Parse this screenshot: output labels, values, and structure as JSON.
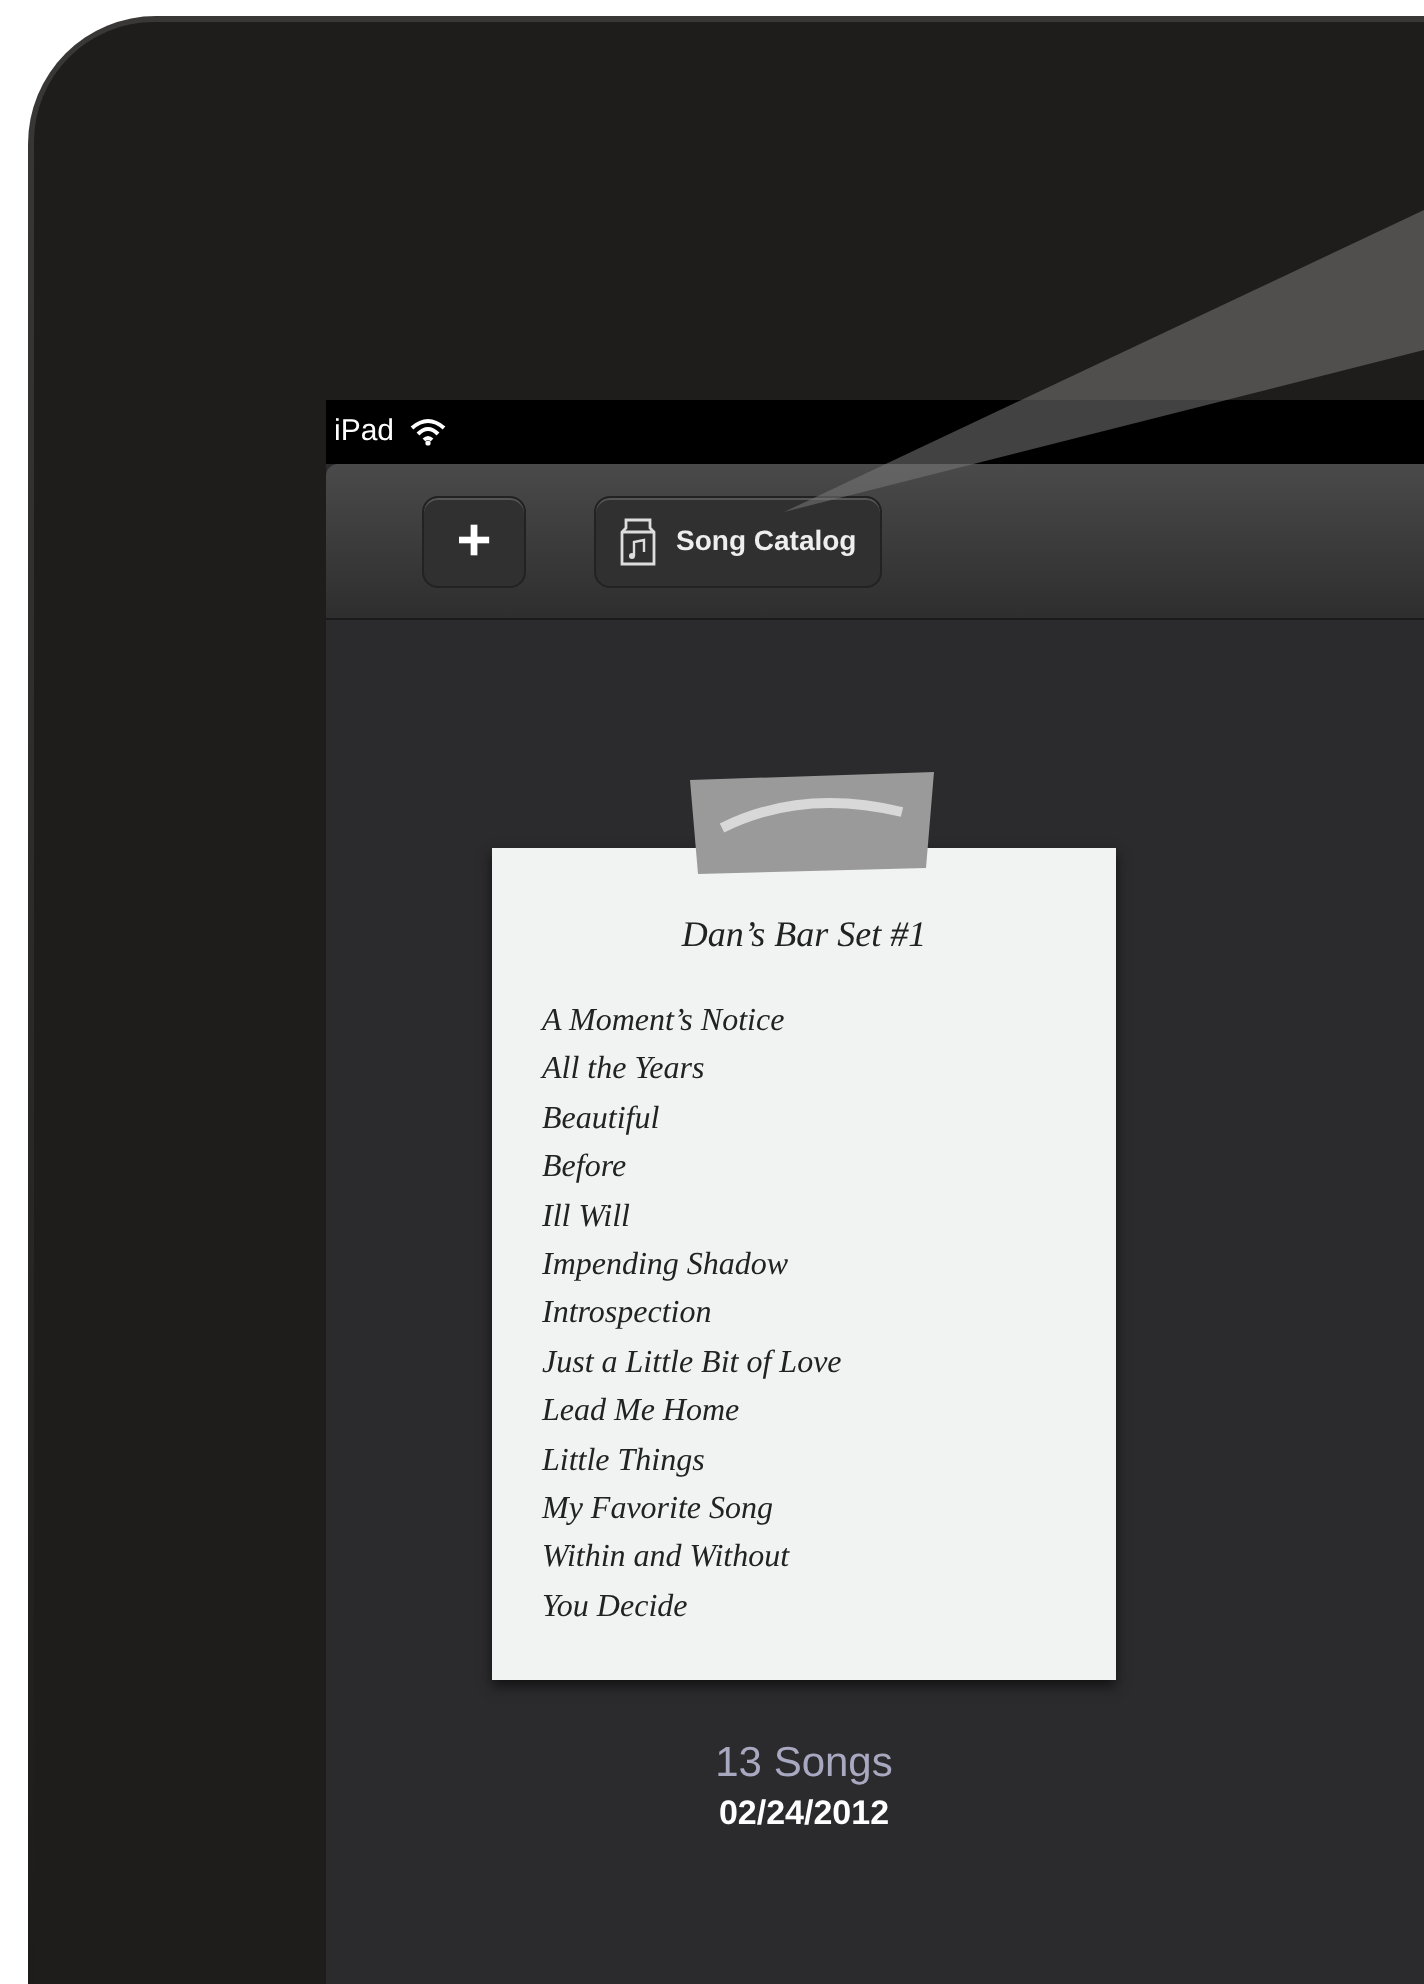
{
  "status_bar": {
    "device": "iPad"
  },
  "toolbar": {
    "add_button": {
      "label": "+"
    },
    "catalog_button": {
      "label": "Song Catalog"
    }
  },
  "setlist": {
    "title": "Dan’s Bar Set #1",
    "songs": [
      "A Moment’s Notice",
      "All the Years",
      "Beautiful",
      "Before",
      "Ill Will",
      "Impending Shadow",
      "Introspection",
      "Just a Little Bit of Love",
      "Lead Me Home",
      "Little Things",
      "My Favorite Song",
      "Within and Without",
      "You Decide"
    ],
    "count": "13 Songs",
    "date": "02/24/2012"
  }
}
